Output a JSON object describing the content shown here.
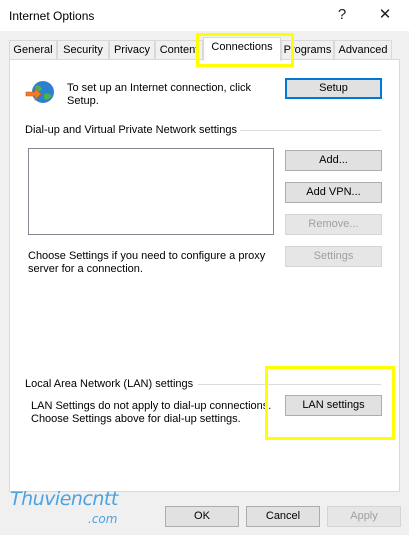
{
  "window": {
    "title": "Internet Options",
    "help_glyph": "?",
    "close_glyph": "✕"
  },
  "tabs": [
    {
      "label": "General"
    },
    {
      "label": "Security"
    },
    {
      "label": "Privacy"
    },
    {
      "label": "Content"
    },
    {
      "label": "Connections",
      "active": true
    },
    {
      "label": "Programs"
    },
    {
      "label": "Advanced"
    }
  ],
  "setup": {
    "text_line1": "To set up an Internet connection, click",
    "text_line2": "Setup.",
    "button": "Setup"
  },
  "dialup": {
    "header": "Dial-up and Virtual Private Network settings",
    "add_button": "Add...",
    "add_vpn_button": "Add VPN...",
    "remove_button": "Remove...",
    "settings_button": "Settings",
    "proxy_text_line1": "Choose Settings if you need to configure a proxy",
    "proxy_text_line2": "server for a connection."
  },
  "lan": {
    "header": "Local Area Network (LAN) settings",
    "text_line1": "LAN Settings do not apply to dial-up connections.",
    "text_line2": "Choose Settings above for dial-up settings.",
    "button": "LAN settings"
  },
  "footer": {
    "ok": "OK",
    "cancel": "Cancel",
    "apply": "Apply"
  },
  "watermark": {
    "line1": "Thuviencntt",
    "line2": ".com"
  },
  "colors": {
    "highlight": "#ffff00",
    "default_button_border": "#0078d7",
    "watermark": "#4aa3e0"
  }
}
